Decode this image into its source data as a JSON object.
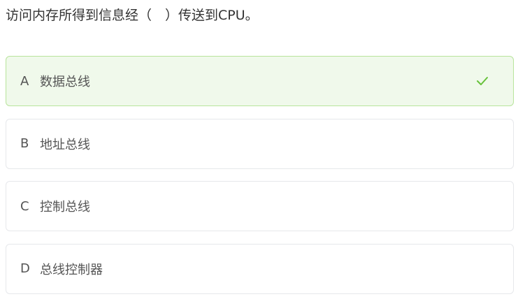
{
  "question": {
    "text": "访问内存所得到信息经（　）传送到CPU。"
  },
  "options": [
    {
      "letter": "A",
      "text": "数据总线",
      "selected": true,
      "icon": "check-icon"
    },
    {
      "letter": "B",
      "text": "地址总线",
      "selected": false
    },
    {
      "letter": "C",
      "text": "控制总线",
      "selected": false
    },
    {
      "letter": "D",
      "text": "总线控制器",
      "selected": false
    }
  ],
  "colors": {
    "selected_background": "#f0f9eb",
    "selected_border": "#b8e49c",
    "check": "#67c23a",
    "border": "#e6e8eb",
    "text": "#555555"
  }
}
